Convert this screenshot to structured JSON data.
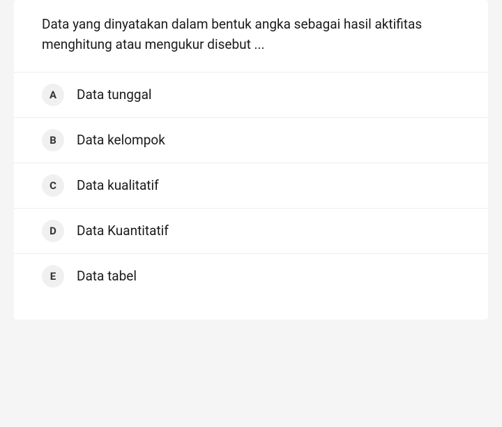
{
  "question": "Data yang dinyatakan dalam bentuk angka sebagai hasil aktifitas menghitung atau mengukur disebut ...",
  "options": [
    {
      "letter": "A",
      "text": "Data tunggal"
    },
    {
      "letter": "B",
      "text": "Data kelompok"
    },
    {
      "letter": "C",
      "text": "Data kualitatif"
    },
    {
      "letter": "D",
      "text": "Data Kuantitatif"
    },
    {
      "letter": "E",
      "text": "Data tabel"
    }
  ]
}
